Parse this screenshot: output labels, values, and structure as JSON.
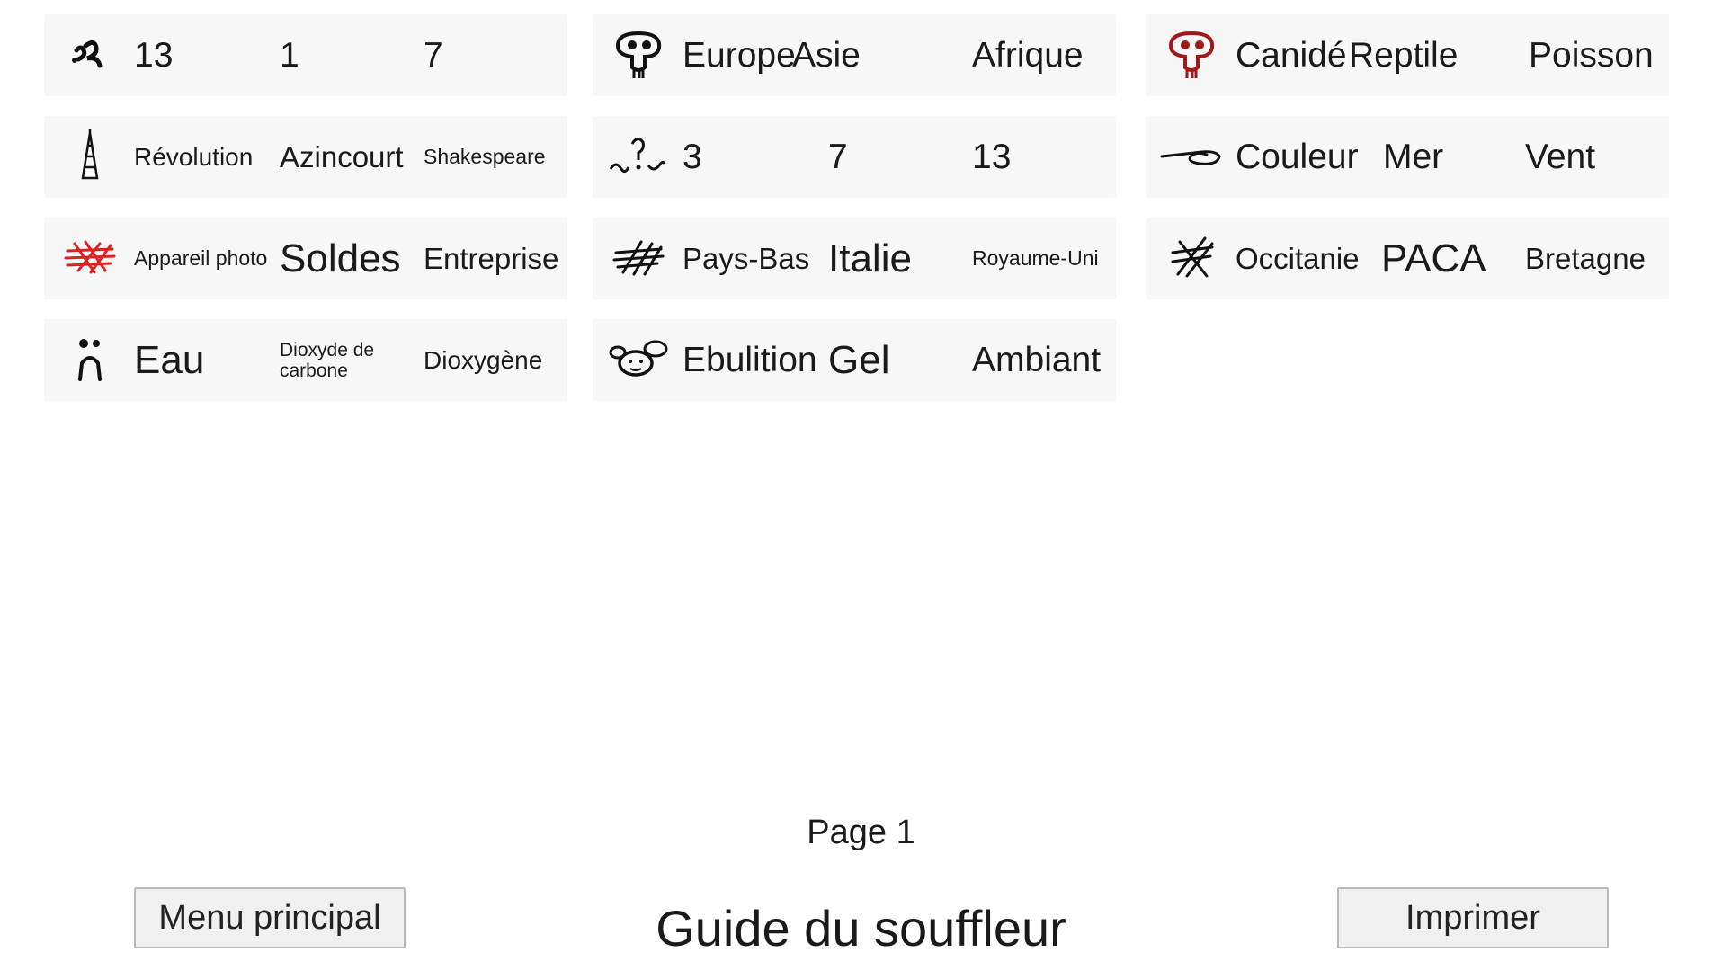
{
  "cards": [
    {
      "icon": "squiggle-glyph-icon",
      "words": [
        "13",
        "1",
        "7"
      ]
    },
    {
      "icon": "tower-glyph-icon",
      "words": [
        "Révolution",
        "Azincourt",
        "Shakespeare"
      ]
    },
    {
      "icon": "crosshatch-red-glyph-icon",
      "icon_color": "#e02020",
      "words": [
        "Appareil photo",
        "Soldes",
        "Entreprise"
      ]
    },
    {
      "icon": "figure-glyph-icon",
      "words": [
        "Eau",
        "Dioxyde de carbone",
        "Dioxygène"
      ]
    },
    {
      "icon": "skull-glyph-icon",
      "words": [
        "Europe",
        "Asie",
        "Afrique"
      ]
    },
    {
      "icon": "question-wave-glyph-icon",
      "words": [
        "3",
        "7",
        "13"
      ]
    },
    {
      "icon": "crosshatch-glyph-icon",
      "words": [
        "Pays-Bas",
        "Italie",
        "Royaume-Uni"
      ]
    },
    {
      "icon": "mouse-face-glyph-icon",
      "words": [
        "Ebulition",
        "Gel",
        "Ambiant"
      ]
    },
    {
      "icon": "skull-red-glyph-icon",
      "icon_color": "#a01818",
      "words": [
        "Canidé",
        "Reptile",
        "Poisson"
      ]
    },
    {
      "icon": "swirl-glyph-icon",
      "words": [
        "Couleur",
        "Mer",
        "Vent"
      ]
    },
    {
      "icon": "cross-lines-glyph-icon",
      "words": [
        "Occitanie",
        "PACA",
        "Bretagne"
      ]
    }
  ],
  "page_label": "Page 1",
  "title": "Guide du souffleur",
  "buttons": {
    "menu": "Menu principal",
    "print": "Imprimer"
  }
}
